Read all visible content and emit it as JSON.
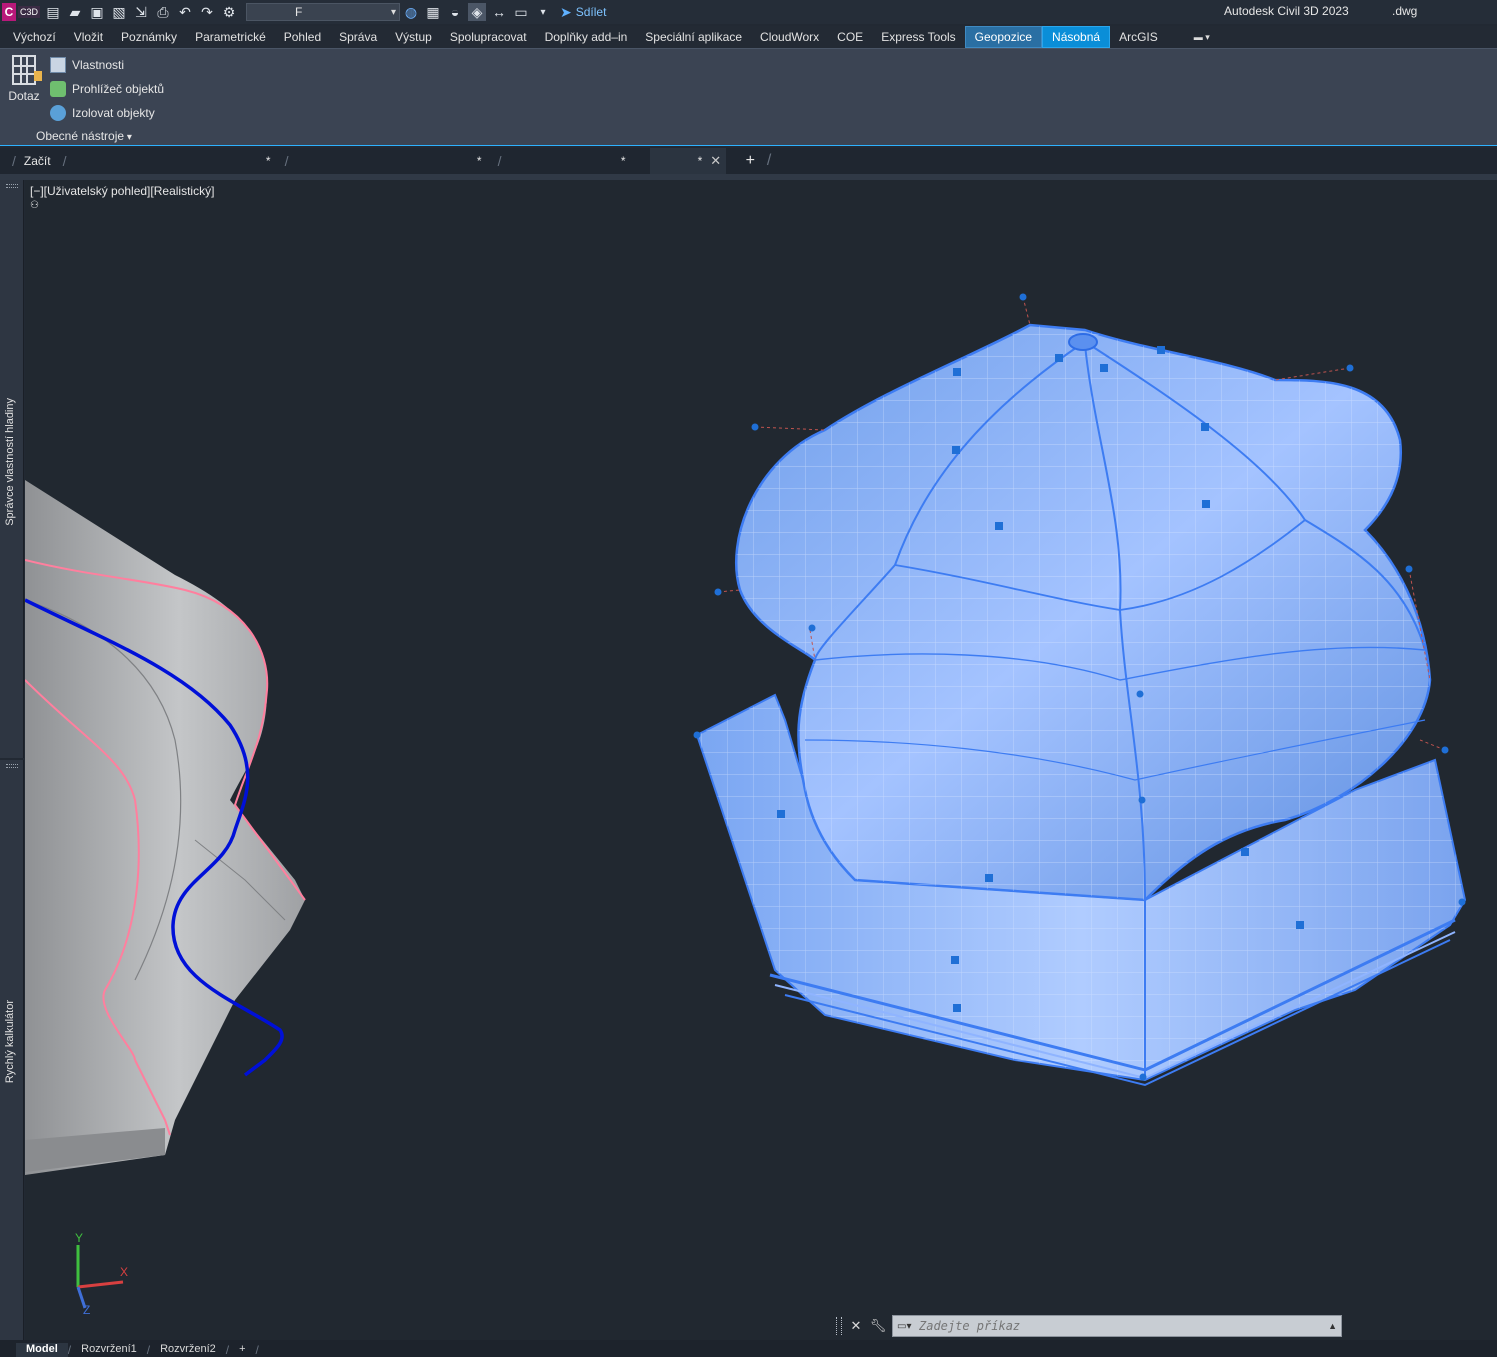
{
  "titlebar": {
    "workspace_value": "F",
    "share_label": "Sdílet",
    "app_title": "Autodesk Civil 3D 2023",
    "file_suffix": ".dwg",
    "logo_letter": "C",
    "logo_badge": "C3D"
  },
  "ribbon_tabs": [
    "Výchozí",
    "Vložit",
    "Poznámky",
    "Parametrické",
    "Pohled",
    "Správa",
    "Výstup",
    "Spolupracovat",
    "Doplňky add–in",
    "Speciální aplikace",
    "CloudWorx",
    "COE",
    "Express Tools",
    "Geopozice",
    "Násobná",
    "ArcGIS"
  ],
  "ribbon_panel": {
    "big_button": "Dotaz",
    "items": [
      "Vlastnosti",
      "Prohlížeč objektů",
      "Izolovat objekty"
    ],
    "panel_title": "Obecné nástroje"
  },
  "file_tabs": {
    "start": "Začít",
    "modified_marker": "*"
  },
  "side_palettes": {
    "top": "Správce vlastností hladiny",
    "bottom": "Rychlý kalkulátor"
  },
  "viewport": {
    "label": "[−][Uživatelský pohled][Realistický]",
    "ucs_x": "X",
    "ucs_y": "Y",
    "ucs_z": "Z"
  },
  "command_line": {
    "placeholder": "Zadejte příkaz"
  },
  "layout_tabs": [
    "Model",
    "Rozvržení1",
    "Rozvržení2"
  ],
  "colors": {
    "accent_tab_a": "#2a6fa3",
    "accent_tab_b": "#0a8ed8",
    "selection_blue": "#4f8fff",
    "gray_solid": "#a9abad",
    "pink_edge": "#ff7f9e",
    "blue_curve": "#0010d8"
  }
}
